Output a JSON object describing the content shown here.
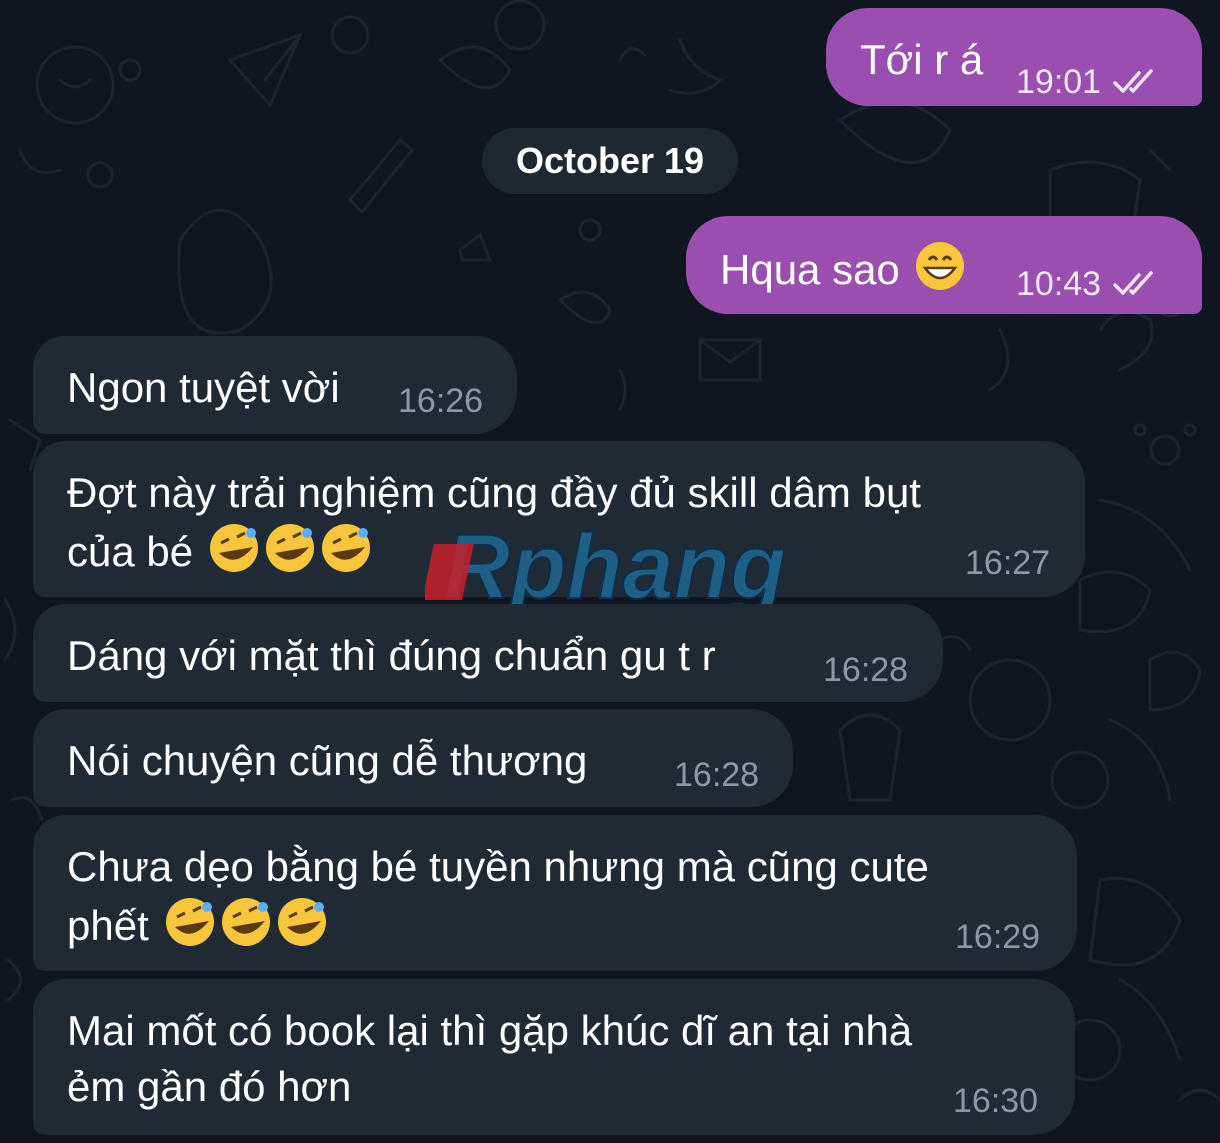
{
  "date_separator": "October 19",
  "watermark_text": "Rphang",
  "messages": [
    {
      "direction": "out",
      "text": "Tới r á",
      "time": "19:01",
      "status_icon": "double-check-icon"
    },
    {
      "direction": "out",
      "text": "Hqua sao",
      "emoji": "grinning-face-icon",
      "time": "10:43",
      "status_icon": "double-check-icon"
    },
    {
      "direction": "in",
      "text": "Ngon tuyệt vời",
      "time": "16:26"
    },
    {
      "direction": "in",
      "text": "Đợt này trải nghiệm cũng đầy đủ skill dâm bụt\ncủa bé",
      "emoji": "rofl-icon ×3",
      "time": "16:27"
    },
    {
      "direction": "in",
      "text": "Dáng với mặt thì đúng chuẩn gu t r",
      "time": "16:28"
    },
    {
      "direction": "in",
      "text": "Nói chuyện cũng dễ thương",
      "time": "16:28"
    },
    {
      "direction": "in",
      "text": "Chưa dẹo bằng bé tuyền nhưng mà cũng cute\nphết",
      "emoji": "rofl-icon ×3",
      "time": "16:29"
    },
    {
      "direction": "in",
      "text": "Mai mốt có book lại thì gặp khúc dĩ an tại nhà\nẻm gần đó hơn",
      "time": "16:30"
    }
  ],
  "colors": {
    "background": "#0f1620",
    "outgoing_bubble": "#9a4fb0",
    "incoming_bubble": "#1f2a35",
    "date_pill": "#1d2833",
    "time_incoming": "#8b98a6"
  }
}
